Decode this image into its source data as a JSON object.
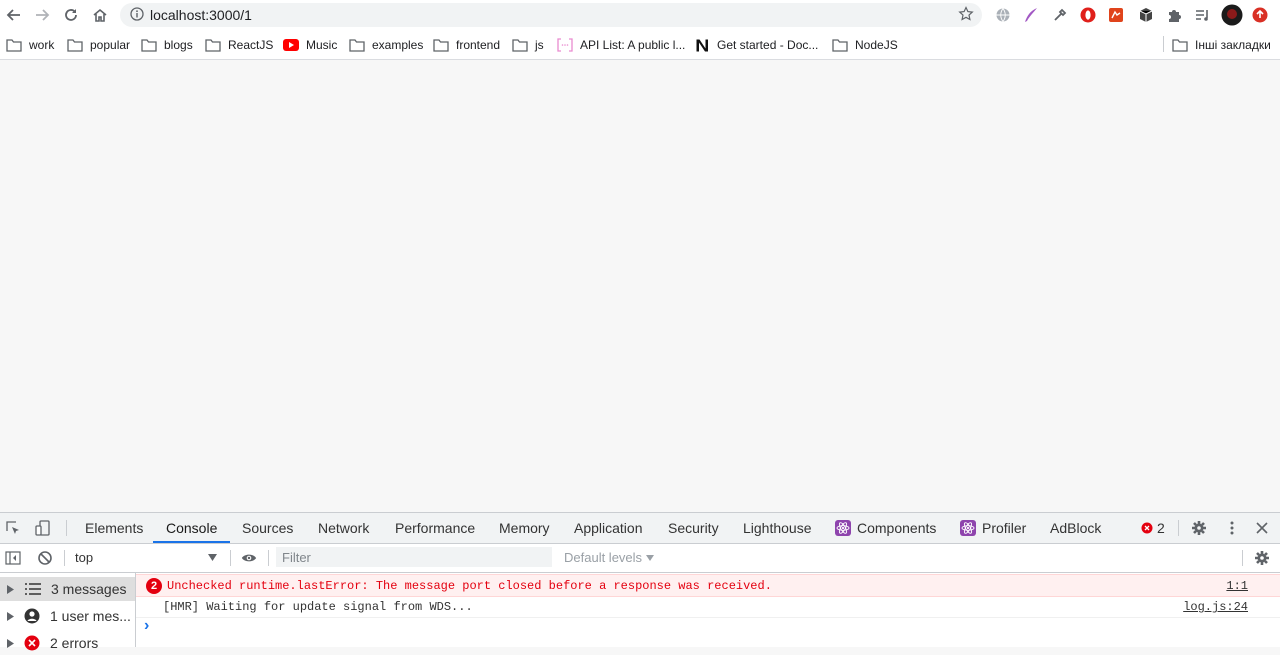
{
  "browser": {
    "url": "localhost:3000/1",
    "bookmarks": [
      {
        "label": "work",
        "icon": "folder-icon"
      },
      {
        "label": "popular",
        "icon": "folder-icon"
      },
      {
        "label": "blogs",
        "icon": "folder-icon"
      },
      {
        "label": "ReactJS",
        "icon": "folder-icon"
      },
      {
        "label": "Music",
        "icon": "youtube-icon"
      },
      {
        "label": "examples",
        "icon": "folder-icon"
      },
      {
        "label": "frontend",
        "icon": "folder-icon"
      },
      {
        "label": "js",
        "icon": "folder-icon"
      },
      {
        "label": "API List: A public l...",
        "icon": "bracket-icon"
      },
      {
        "label": "Get started - Doc...",
        "icon": "notion-icon"
      },
      {
        "label": "NodeJS",
        "icon": "folder-icon"
      }
    ],
    "other_bookmarks": "Інші закладки"
  },
  "devtools": {
    "tabs": [
      "Elements",
      "Console",
      "Sources",
      "Network",
      "Performance",
      "Memory",
      "Application",
      "Security",
      "Lighthouse",
      "Components",
      "Profiler",
      "AdBlock"
    ],
    "active_tab": "Console",
    "error_count": "2",
    "context": "top",
    "filter_placeholder": "Filter",
    "levels": "Default levels",
    "sidebar": [
      {
        "label": "3 messages",
        "icon": "list-icon"
      },
      {
        "label": "1 user mes...",
        "icon": "user-icon"
      },
      {
        "label": "2 errors",
        "icon": "error-icon"
      }
    ],
    "messages": [
      {
        "count": "2",
        "text": "Unchecked runtime.lastError: The message port closed before a response was received.",
        "source": "1:1",
        "level": "error"
      },
      {
        "text": "[HMR] Waiting for update signal from WDS...",
        "source": "log.js:24",
        "level": "log"
      }
    ],
    "prompt": "›"
  },
  "colors": {
    "accent": "#1a73e8",
    "error": "#e4000f",
    "error_bg": "#fff0f0",
    "react": "#8e44ad"
  }
}
